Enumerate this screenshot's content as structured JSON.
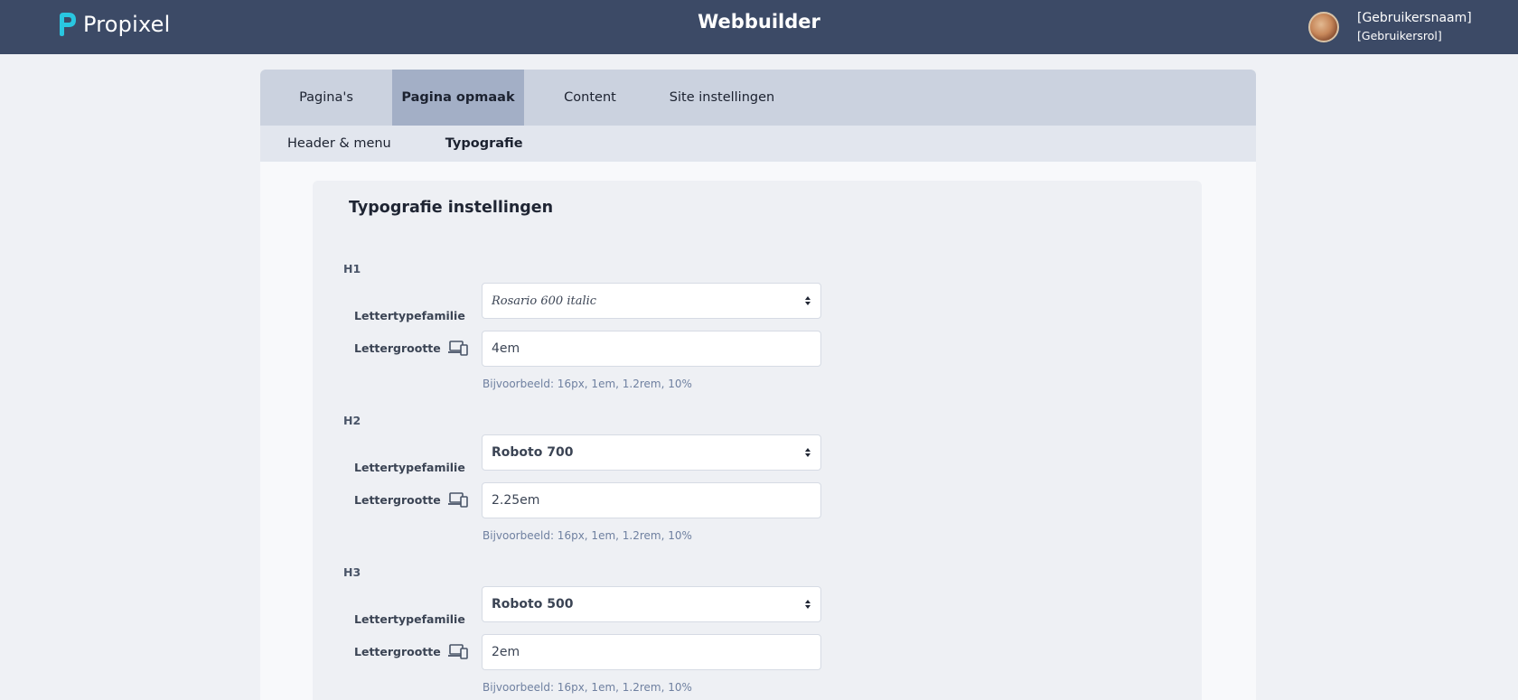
{
  "topbar": {
    "brand": "Propixel",
    "app_title": "Webbuilder",
    "user_name": "[Gebruikersnaam]",
    "user_role": "[Gebruikersrol]",
    "colors": {
      "background": "#3c4a66",
      "logo_accent": "#29c6e0"
    }
  },
  "tabs": [
    {
      "label": "Pagina's",
      "active": false
    },
    {
      "label": "Pagina opmaak",
      "active": true
    },
    {
      "label": "Content",
      "active": false
    },
    {
      "label": "Site instellingen",
      "active": false
    }
  ],
  "subtabs": [
    {
      "label": "Header & menu",
      "active": false
    },
    {
      "label": "Typografie",
      "active": true
    }
  ],
  "card": {
    "title": "Typografie instellingen",
    "sections": [
      {
        "heading": "H1",
        "family_label": "Lettertypefamilie",
        "family_value": "Rosario 600 italic",
        "size_label": "Lettergrootte",
        "size_value": "4em",
        "hint": "Bijvoorbeeld: 16px, 1em, 1.2rem, 10%"
      },
      {
        "heading": "H2",
        "family_label": "Lettertypefamilie",
        "family_value": "Roboto 700",
        "size_label": "Lettergrootte",
        "size_value": "2.25em",
        "hint": "Bijvoorbeeld: 16px, 1em, 1.2rem, 10%"
      },
      {
        "heading": "H3",
        "family_label": "Lettertypefamilie",
        "family_value": "Roboto 500",
        "size_label": "Lettergrootte",
        "size_value": "2em",
        "hint": "Bijvoorbeeld: 16px, 1em, 1.2rem, 10%"
      }
    ],
    "icons": {
      "size_icon": "responsive-devices-icon",
      "select_icon": "sort-arrows-icon"
    }
  }
}
